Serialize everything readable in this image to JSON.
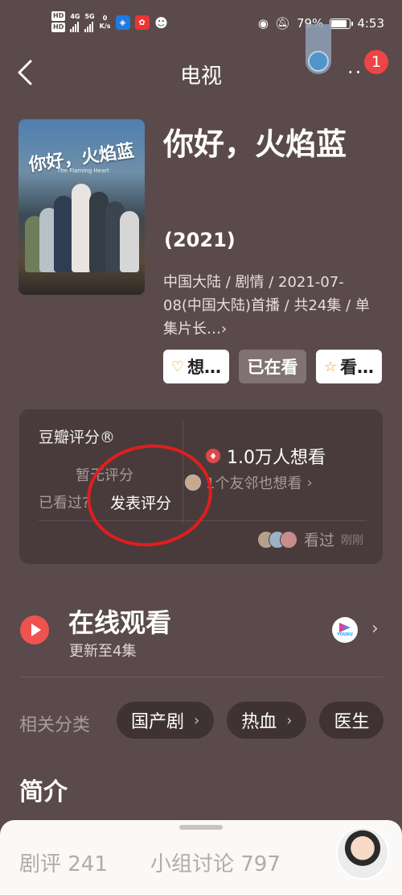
{
  "status_bar": {
    "hd1": "HD",
    "hd2": "HD",
    "net_type": "4G",
    "net_type2": "5G",
    "speed_value": "0",
    "speed_unit": "K/s",
    "battery": "79%",
    "time": "4:53"
  },
  "nav": {
    "title": "电视",
    "badge_count": "1"
  },
  "movie": {
    "poster_title": "你好，火焰蓝",
    "poster_subtitle": "The Flaming Heart",
    "title": "你好，火焰蓝",
    "year": "(2021)",
    "meta": "中国大陆 / 剧情 / 2021-07-08(中国大陆)首播 / 共24集 / 单集片长…",
    "meta_arrow": "›"
  },
  "actions": {
    "want": "想…",
    "watching": "已在看",
    "watched": "看…"
  },
  "rating": {
    "title": "豆瓣评分®",
    "none": "暂无评分",
    "seen": "已看过?",
    "post": "发表评分",
    "want_count": "1.0万人想看",
    "friend_text": "1个友邻也想看",
    "seen_label": "看过",
    "seen_time": "刚刚"
  },
  "watch": {
    "title": "在线观看",
    "subtitle": "更新至4集",
    "provider": "YOUKU"
  },
  "categories": {
    "label": "相关分类",
    "items": [
      "国产剧",
      "热血",
      "医生"
    ]
  },
  "intro": {
    "title": "简介"
  },
  "bottom_tabs": {
    "reviews": "剧评 241",
    "groups": "小组讨论 797"
  },
  "colors": {
    "background": "#5b4a4b",
    "card": "#493b3c",
    "accent_red": "#ef5350",
    "annotation_red": "#e11d1d"
  }
}
